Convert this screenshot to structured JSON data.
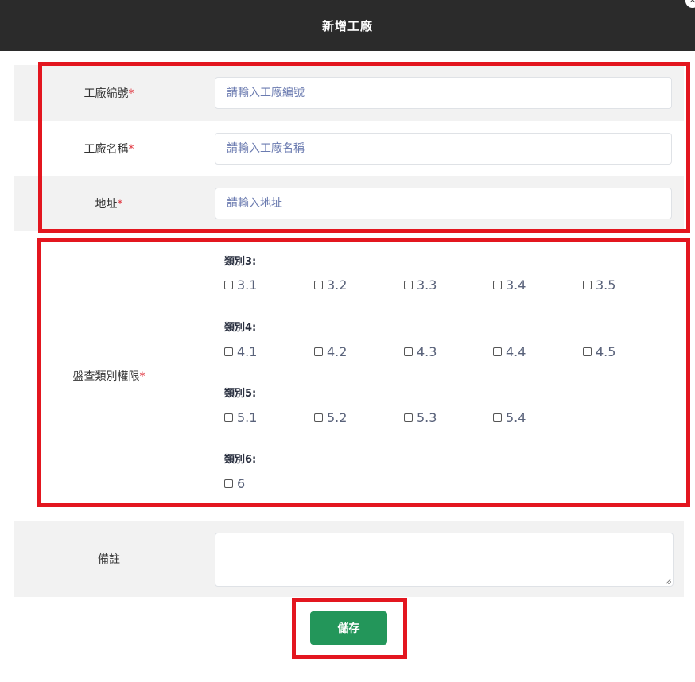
{
  "header": {
    "title": "新增工廠",
    "close_icon": "close-icon"
  },
  "fields": {
    "code": {
      "label": "工廠編號",
      "required_mark": "*",
      "placeholder": "請輸入工廠編號"
    },
    "name": {
      "label": "工廠名稱",
      "required_mark": "*",
      "placeholder": "請輸入工廠名稱"
    },
    "address": {
      "label": "地址",
      "required_mark": "*",
      "placeholder": "請輸入地址"
    }
  },
  "permissions": {
    "label": "盤查類別權限",
    "required_mark": "*",
    "groups": [
      {
        "title": "類別3:",
        "options": [
          "3.1",
          "3.2",
          "3.3",
          "3.4",
          "3.5"
        ]
      },
      {
        "title": "類別4:",
        "options": [
          "4.1",
          "4.2",
          "4.3",
          "4.4",
          "4.5"
        ]
      },
      {
        "title": "類別5:",
        "options": [
          "5.1",
          "5.2",
          "5.3",
          "5.4"
        ]
      },
      {
        "title": "類別6:",
        "options": [
          "6"
        ]
      }
    ]
  },
  "notes": {
    "label": "備註",
    "value": ""
  },
  "actions": {
    "save_label": "儲存"
  },
  "colors": {
    "header_bg": "#2b2b2b",
    "highlight_border": "#e3161f",
    "save_button": "#23965a",
    "required": "#e0313b"
  }
}
